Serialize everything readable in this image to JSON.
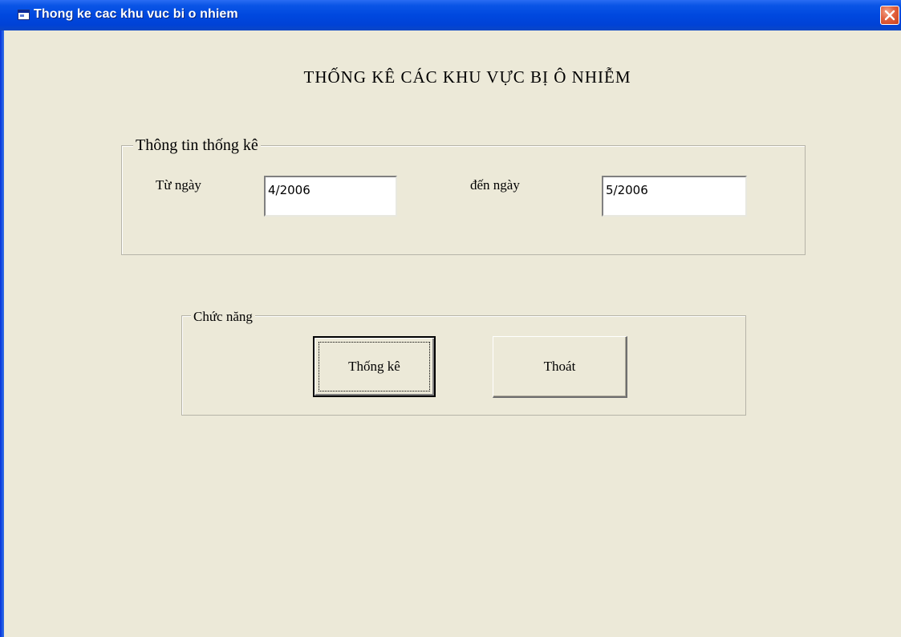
{
  "window": {
    "title": "Thong ke cac khu vuc bi o nhiem",
    "icon": "form-window-icon",
    "close_icon": "close-icon"
  },
  "heading": "THỐNG KÊ CÁC KHU VỰC BỊ Ô NHIỄM",
  "info_group": {
    "legend": "Thông tin thống kê",
    "from_label": "Từ ngày",
    "from_value": "4/2006",
    "to_label": "đến ngày",
    "to_value": "5/2006"
  },
  "function_group": {
    "legend": "Chức năng",
    "stats_button": "Thống kê",
    "exit_button": "Thoát"
  },
  "colors": {
    "titlebar": "#0048df",
    "window_bg": "#ece9d8",
    "close_button": "#e2613e"
  }
}
